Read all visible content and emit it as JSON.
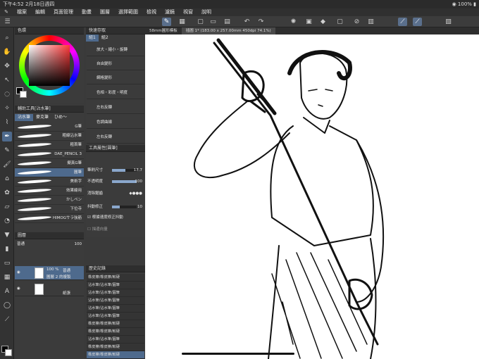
{
  "status": {
    "time": "下午4:52",
    "date": "2月18日週四",
    "battery": "100%"
  },
  "menu": [
    "檔案",
    "編輯",
    "頁面管理",
    "動畫",
    "圖層",
    "選擇範圍",
    "檢視",
    "濾鏡",
    "視窗",
    "說明"
  ],
  "panels": {
    "color": {
      "title": "色環"
    },
    "quick_access": {
      "title": "快速存取",
      "tabs": [
        "組1",
        "組2"
      ],
      "items": [
        "放大・縮小・旋轉",
        "自由變形",
        "網格變形",
        "色相・彩度・明度",
        "左右反轉",
        "色調曲線",
        "左右反轉"
      ]
    },
    "subtool": {
      "title": "輔助工具[沾水筆]",
      "tabs": [
        "沾水筆",
        "麥克筆",
        "ひめ〜"
      ],
      "brushes": [
        "G筆",
        "粗線沾水筆",
        "粗首筆",
        "DAE_PENCIL 3",
        "擬真G筆",
        "圓筆",
        "美術字",
        "效果線用",
        "かしペン",
        "下位寺",
        "HIMOGサラ強筋"
      ]
    },
    "tool_property": {
      "title": "工具屬性[圓筆]",
      "rows": [
        {
          "label": "筆刷尺寸",
          "value": "17.7",
          "fill": 0.55
        },
        {
          "label": "不透明度",
          "value": "100",
          "fill": 1.0
        },
        {
          "label": "消除鋸齒",
          "value": "",
          "fill": 0.0
        },
        {
          "label": "抖動修正",
          "value": "10",
          "fill": 0.3
        },
        {
          "label": "根據速度修正抖動",
          "value": "",
          "fill": 0.0
        },
        {
          "label": "描邊向量",
          "value": "",
          "fill": 0.0
        }
      ]
    },
    "layer": {
      "title": "圖層",
      "blend": "普通",
      "opacity": "100",
      "rows": [
        {
          "percent": "100 %",
          "mode": "普通",
          "name": "圖層 2 的複製"
        },
        {
          "percent": "",
          "mode": "",
          "name": "紙張"
        }
      ]
    },
    "history": {
      "title": "歷史記錄",
      "items": [
        "橡皮擦/橡皮擦/較硬",
        "沾水筆/沾水筆/圓筆",
        "沾水筆/沾水筆/圓筆",
        "沾水筆/沾水筆/圓筆",
        "沾水筆/沾水筆/圓筆",
        "沾水筆/沾水筆/圓筆",
        "橡皮擦/橡皮擦/較硬",
        "橡皮擦/橡皮擦/較硬",
        "沾水筆/沾水筆/圓筆",
        "橡皮擦/橡皮擦/較硬",
        "橡皮擦/橡皮擦/較硬",
        "橡皮擦/橡皮擦/較硬"
      ]
    }
  },
  "canvas": {
    "tabs": [
      "58mm圓形模板",
      "插圖 1* (183.00 x 257.00mm 450dpi 74.1%)"
    ]
  },
  "colors": {
    "accent": "#4e6a8d",
    "panel": "#3b3b3b",
    "dark": "#2e2e2e"
  }
}
